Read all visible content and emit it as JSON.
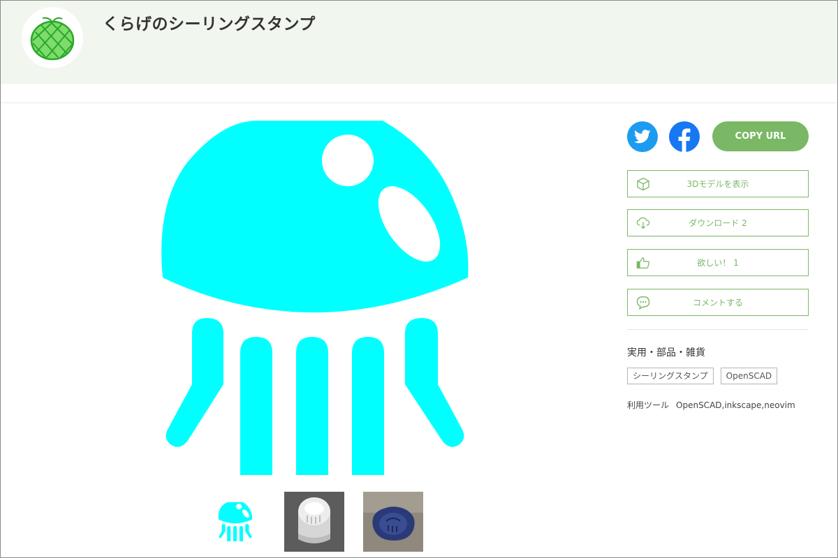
{
  "header": {
    "title": "くらげのシーリングスタンプ",
    "avatar_icon": "melon-icon"
  },
  "share": {
    "twitter_icon": "twitter-icon",
    "facebook_icon": "facebook-icon",
    "copy_url_label": "COPY URL"
  },
  "actions": {
    "view_3d_label": "3Dモデルを表示",
    "download_label": "ダウンロード 2",
    "want_label": "欲しい！ 1",
    "comment_label": "コメントする"
  },
  "category": "実用・部品・雑貨",
  "tags": [
    "シーリングスタンプ",
    "OpenSCAD"
  ],
  "tools": {
    "label": "利用ツール",
    "value": "OpenSCAD,inkscape,neovim"
  },
  "colors": {
    "accent": "#7ab865",
    "jellyfish": "#00ffff",
    "header_bg": "#f1f6ef",
    "twitter": "#1d9bf0",
    "facebook": "#1877f2"
  }
}
